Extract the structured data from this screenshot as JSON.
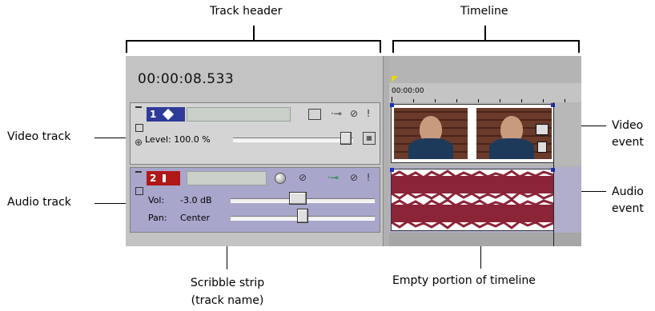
{
  "callouts": {
    "track_header": "Track header",
    "timeline": "Timeline",
    "video_track": "Video track",
    "audio_track": "Audio track",
    "video_event_1": "Video",
    "video_event_2": "event",
    "audio_event_1": "Audio",
    "audio_event_2": "event",
    "scribble_1": "Scribble strip",
    "scribble_2": "(track name)",
    "empty_timeline": "Empty portion of timeline"
  },
  "timecode": "00:00:08.533",
  "ruler_start": "00:00:00",
  "video_track": {
    "number": "1",
    "level_label": "Level: 100.0 %",
    "level_fraction": 1.0
  },
  "audio_track": {
    "number": "2",
    "vol_label": "Vol:",
    "vol_value": "-3.0 dB",
    "pan_label": "Pan:",
    "pan_value": "Center",
    "vol_fraction": 0.47,
    "pan_fraction": 0.5
  },
  "icons": {
    "video_track_icon": "film-diamond-icon",
    "audio_track_icon": "speaker-icon",
    "compositing": "compositing-icon",
    "fx": "fx-plugin-icon",
    "mute": "mute-icon",
    "solo": "solo-icon",
    "record": "record-icon"
  },
  "colors": {
    "video_track_bg": "#d4d4d4",
    "audio_track_bg": "#a9a6cc",
    "video_number_bg": "#2e3b98",
    "audio_number_bg": "#b01818",
    "waveform": "#8c2438",
    "marker": "#e8d800"
  }
}
